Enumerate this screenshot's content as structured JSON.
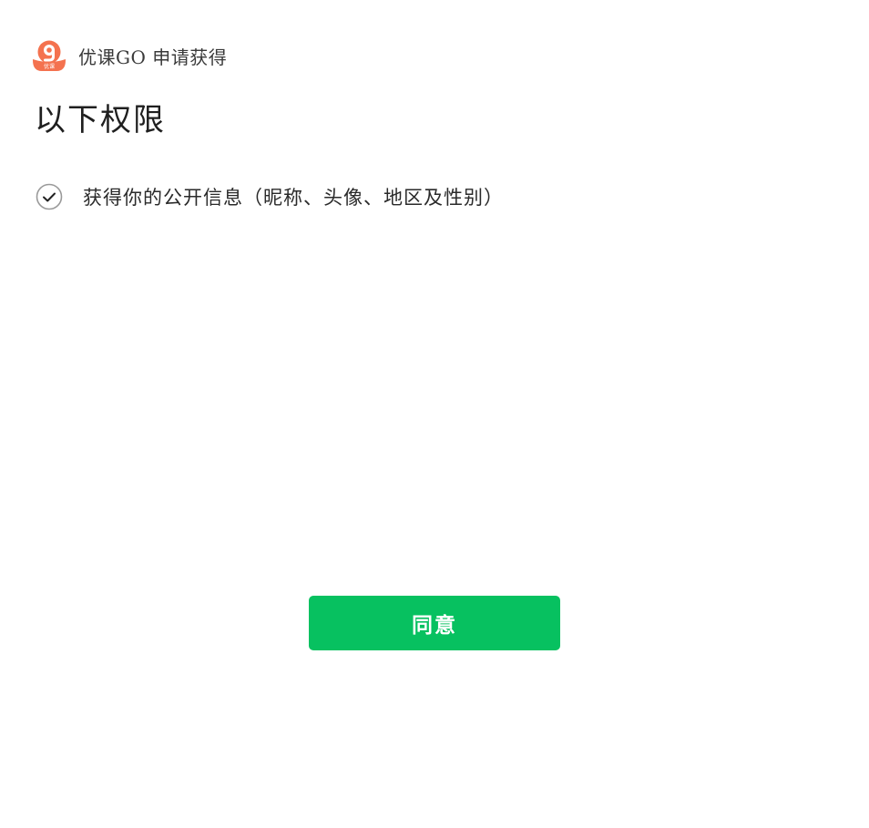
{
  "header": {
    "logo_icon": "youke-go-logo-icon",
    "logo_badge_text": "优课",
    "title": "优课GO 申请获得"
  },
  "main": {
    "title": "以下权限",
    "permissions": [
      {
        "icon": "check-circle-icon",
        "label": "获得你的公开信息（昵称、头像、地区及性别）",
        "checked": true
      }
    ]
  },
  "actions": {
    "agree_label": "同意"
  },
  "colors": {
    "accent": "#07c160",
    "logo": "#f4724f"
  }
}
